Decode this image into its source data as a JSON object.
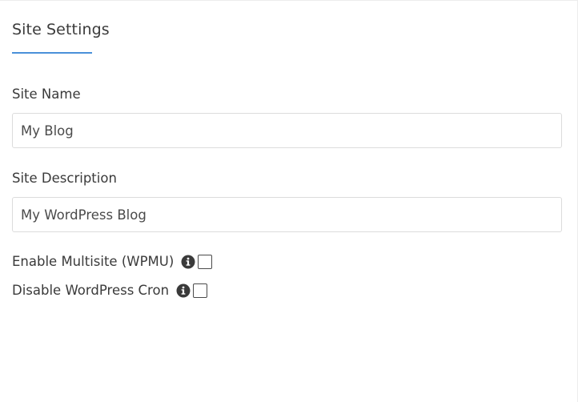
{
  "section": {
    "title": "Site Settings"
  },
  "site_name": {
    "label": "Site Name",
    "value": "My Blog"
  },
  "site_description": {
    "label": "Site Description",
    "value": "My WordPress Blog"
  },
  "options": [
    {
      "label": "Enable Multisite (WPMU)",
      "checked": false
    },
    {
      "label": "Disable WordPress Cron",
      "checked": false
    }
  ],
  "colors": {
    "accent": "#4a90d9",
    "icon": "#3a3a3a"
  },
  "icons": {
    "info": "info-circle-icon"
  }
}
